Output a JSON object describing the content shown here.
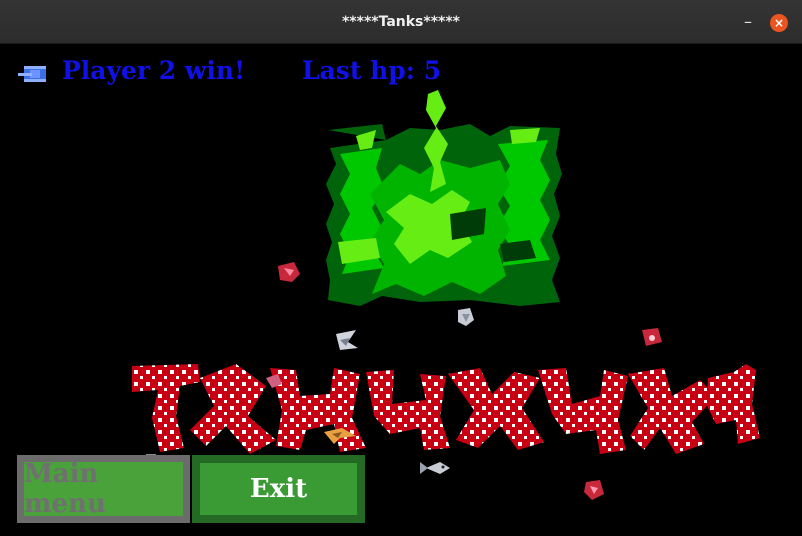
{
  "window": {
    "title": "*****Tanks*****",
    "minimize_glyph": "–",
    "close_glyph": "×"
  },
  "hud": {
    "status": "Player 2 win!",
    "hp_text": "Last hp: 5",
    "player_icon": "tank-icon"
  },
  "buttons": {
    "main_menu": "Main menu",
    "exit": "Exit"
  },
  "colors": {
    "hud_text": "#1010e8",
    "tank_light": "#66ee14",
    "tank_mid": "#00c800",
    "tank_dark": "#00640a",
    "logo_red": "#c80014",
    "button_green": "#4aa23a",
    "close_orange": "#e95420"
  }
}
